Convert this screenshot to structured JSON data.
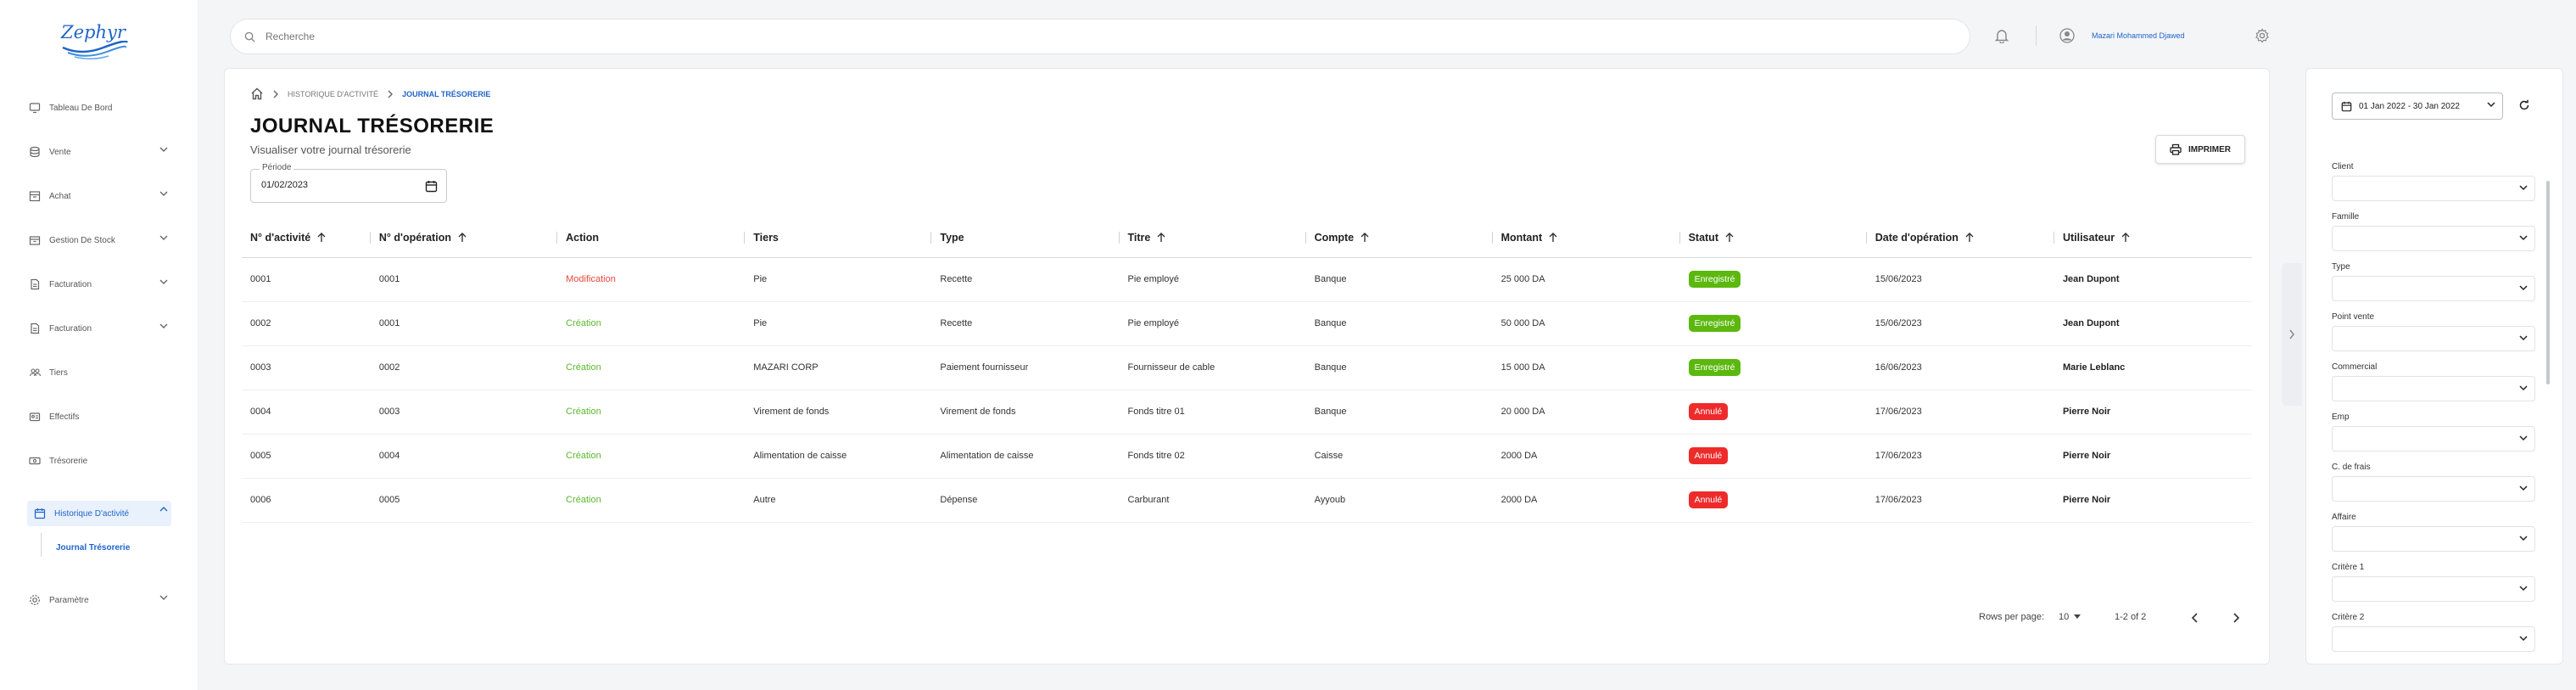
{
  "brand": {
    "name": "Zephyr"
  },
  "sidebar": {
    "items": [
      {
        "label": "Tableau De Bord",
        "icon": "monitor-icon",
        "chevron": false
      },
      {
        "label": "Vente",
        "icon": "database-icon",
        "chevron": true
      },
      {
        "label": "Achat",
        "icon": "building-icon",
        "chevron": true
      },
      {
        "label": "Gestion De Stock",
        "icon": "box-icon",
        "chevron": true
      },
      {
        "label": "Facturation",
        "icon": "invoice-icon",
        "chevron": true
      },
      {
        "label": "Facturation",
        "icon": "invoice-icon",
        "chevron": true
      },
      {
        "label": "Tiers",
        "icon": "users-icon",
        "chevron": false
      },
      {
        "label": "Effectifs",
        "icon": "id-card-icon",
        "chevron": false
      },
      {
        "label": "Trésorerie",
        "icon": "cash-icon",
        "chevron": false
      },
      {
        "label": "Historique D'activité",
        "icon": "history-icon",
        "chevron": true,
        "active": true
      },
      {
        "label": "Paramètre",
        "icon": "gear-icon",
        "chevron": true
      }
    ],
    "sub_item": "Journal Trésorerie"
  },
  "topbar": {
    "search_placeholder": "Recherche",
    "user_name": "Mazari Mohammed Djawed"
  },
  "breadcrumb": {
    "parent": "HISTORIQUE D'ACTIVITÉ",
    "current": "JOURNAL TRÉSORERIE"
  },
  "page": {
    "title": "JOURNAL TRÉSORERIE",
    "subtitle": "Visualiser votre journal trésorerie",
    "period_label": "Période",
    "period_value": "01/02/2023",
    "print_label": "IMPRIMER"
  },
  "table": {
    "columns": [
      "N° d'activité",
      "N° d'opération",
      "Action",
      "Tiers",
      "Type",
      "Titre",
      "Compte",
      "Montant",
      "Statut",
      "Date d'opération",
      "Utilisateur"
    ],
    "sortable": [
      true,
      true,
      false,
      false,
      false,
      true,
      true,
      true,
      true,
      true,
      true
    ],
    "rows": [
      {
        "activite": "0001",
        "operation": "0001",
        "action": "Modification",
        "tiers": "Pie",
        "type": "Recette",
        "titre": "Pie employé",
        "compte": "Banque",
        "montant": "25 000 DA",
        "statut": "Enregistré",
        "date": "15/06/2023",
        "user": "Jean Dupont"
      },
      {
        "activite": "0002",
        "operation": "0001",
        "action": "Création",
        "tiers": "Pie",
        "type": "Recette",
        "titre": "Pie employé",
        "compte": "Banque",
        "montant": "50 000 DA",
        "statut": "Enregistré",
        "date": "15/06/2023",
        "user": "Jean Dupont"
      },
      {
        "activite": "0003",
        "operation": "0002",
        "action": "Création",
        "tiers": "MAZARI CORP",
        "type": "Paiement fournisseur",
        "titre": "Fournisseur de cable",
        "compte": "Banque",
        "montant": "15 000 DA",
        "statut": "Enregistré",
        "date": "16/06/2023",
        "user": "Marie Leblanc"
      },
      {
        "activite": "0004",
        "operation": "0003",
        "action": "Création",
        "tiers": "Virement de fonds",
        "type": "Virement de fonds",
        "titre": "Fonds titre 01",
        "compte": "Banque",
        "montant": "20 000 DA",
        "statut": "Annulé",
        "date": "17/06/2023",
        "user": "Pierre Noir"
      },
      {
        "activite": "0005",
        "operation": "0004",
        "action": "Création",
        "tiers": "Alimentation de caisse",
        "type": "Alimentation de caisse",
        "titre": "Fonds titre 02",
        "compte": "Caisse",
        "montant": "2000 DA",
        "statut": "Annulé",
        "date": "17/06/2023",
        "user": "Pierre Noir"
      },
      {
        "activite": "0006",
        "operation": "0005",
        "action": "Création",
        "tiers": "Autre",
        "type": "Dépense",
        "titre": "Carburant",
        "compte": "Ayyoub",
        "montant": "2000 DA",
        "statut": "Annulé",
        "date": "17/06/2023",
        "user": "Pierre Noir"
      }
    ]
  },
  "pagination": {
    "rows_label": "Rows per page:",
    "rows_value": "10",
    "range": "1-2 of 2"
  },
  "filters": {
    "date_range": "01 Jan 2022 - 30 Jan 2022",
    "fields": [
      "Client",
      "Famille",
      "Type",
      "Point vente",
      "Commercial",
      "Emp",
      "C. de frais",
      "Affaire",
      "Critère 1",
      "Critère 2"
    ]
  },
  "colors": {
    "accent": "#1f64c8",
    "action_modification": "#e8483a",
    "action_creation": "#5cb82e",
    "status_enregistre": "#5cb80f",
    "status_annule": "#ee2b2b"
  }
}
